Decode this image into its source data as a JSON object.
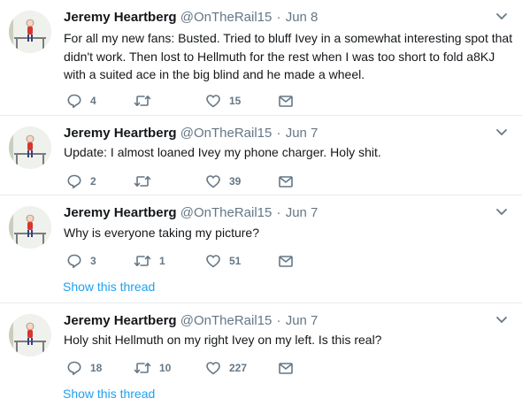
{
  "colors": {
    "accent": "#1da1f2",
    "secondary_text": "#657786",
    "divider": "#e6ecf0"
  },
  "tweets": [
    {
      "name": "Jeremy Heartberg",
      "handle": "@OnTheRail15",
      "date": "Jun 8",
      "text": "For all my new fans: Busted. Tried to bluff Ivey in a somewhat interesting spot that didn't work. Then lost to Hellmuth for the rest when I was too short to fold a8KJ with a suited ace in the big blind and he made a wheel.",
      "reply_count": "4",
      "retweet_count": "",
      "like_count": "15",
      "show_thread": ""
    },
    {
      "name": "Jeremy Heartberg",
      "handle": "@OnTheRail15",
      "date": "Jun 7",
      "text": "Update: I almost loaned Ivey my phone charger. Holy shit.",
      "reply_count": "2",
      "retweet_count": "",
      "like_count": "39",
      "show_thread": ""
    },
    {
      "name": "Jeremy Heartberg",
      "handle": "@OnTheRail15",
      "date": "Jun 7",
      "text": "Why is everyone taking my picture?",
      "reply_count": "3",
      "retweet_count": "1",
      "like_count": "51",
      "show_thread": "Show this thread"
    },
    {
      "name": "Jeremy Heartberg",
      "handle": "@OnTheRail15",
      "date": "Jun 7",
      "text": "Holy shit Hellmuth on my right Ivey on my left. Is this real?",
      "reply_count": "18",
      "retweet_count": "10",
      "like_count": "227",
      "show_thread": "Show this thread"
    }
  ]
}
